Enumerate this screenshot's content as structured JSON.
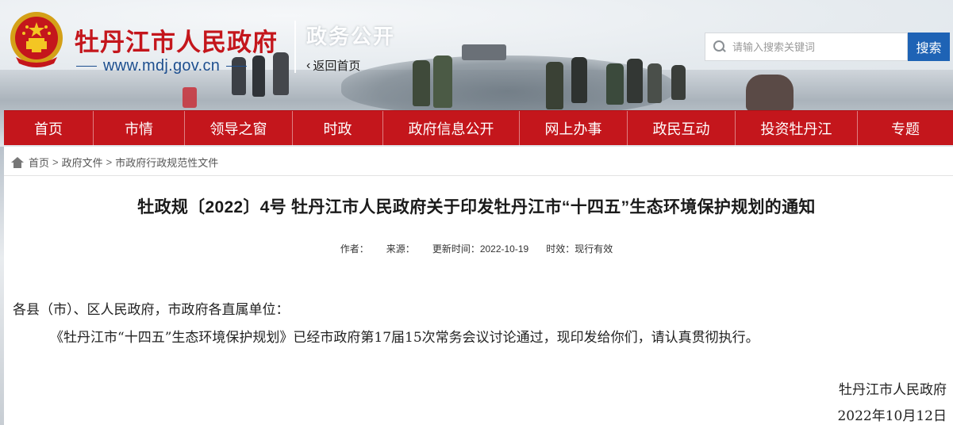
{
  "header": {
    "site_name": "牡丹江市人民政府",
    "site_url": "www.mdj.gov.cn",
    "section_name": "政务公开",
    "back_home": "返回首页"
  },
  "search": {
    "placeholder": "请输入搜索关键词",
    "button_label": "搜索"
  },
  "nav": {
    "items": [
      {
        "label": "首页"
      },
      {
        "label": "市情"
      },
      {
        "label": "领导之窗"
      },
      {
        "label": "时政"
      },
      {
        "label": "政府信息公开"
      },
      {
        "label": "网上办事"
      },
      {
        "label": "政民互动"
      },
      {
        "label": "投资牡丹江"
      },
      {
        "label": "专题"
      }
    ]
  },
  "breadcrumb": {
    "items": [
      "首页",
      "政府文件",
      "市政府行政规范性文件"
    ],
    "separator": ">"
  },
  "article": {
    "title": "牡政规〔2022〕4号 牡丹江市人民政府关于印发牡丹江市“十四五”生态环境保护规划的通知",
    "meta": {
      "author": "作者：",
      "source": "来源：",
      "updated": "更新时间：2022-10-19",
      "validity": "时效：现行有效"
    },
    "salutation": "各县（市）、区人民政府，市政府各直属单位：",
    "paragraph": "《牡丹江市“十四五”生态环境保护规划》已经市政府第17届15次常务会议讨论通过，现印发给你们，请认真贯彻执行。",
    "signature_org": "牡丹江市人民政府",
    "signature_date": "2022年10月12日"
  },
  "colors": {
    "brand_red": "#c4161c",
    "url_blue": "#1e4f8f",
    "search_blue": "#1e63b5"
  }
}
